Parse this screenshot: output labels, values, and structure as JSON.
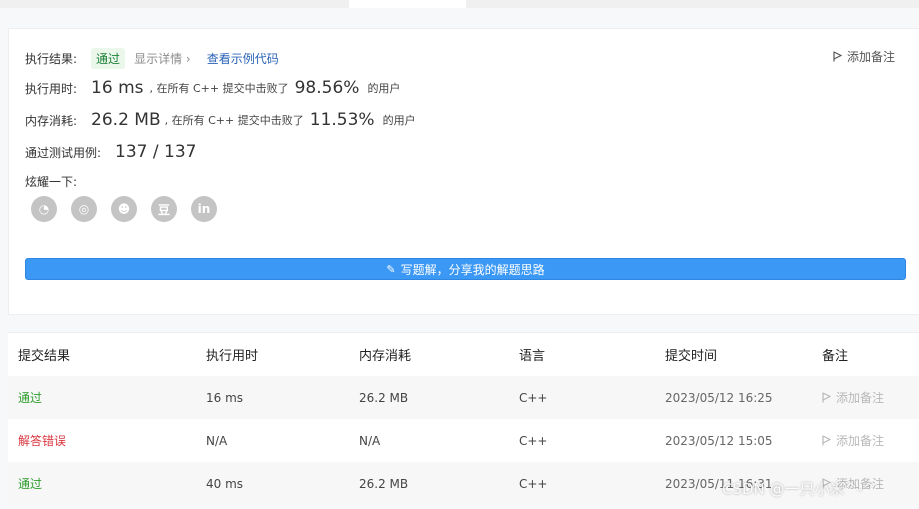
{
  "result": {
    "status_label": "执行结果:",
    "status_value": "通过",
    "show_detail": "显示详情",
    "detail_chevron": "›",
    "view_example_code": "查看示例代码",
    "add_note": "添加备注",
    "runtime_label": "执行用时:",
    "runtime_value": "16 ms",
    "runtime_mid": ", 在所有 C++ 提交中击败了",
    "runtime_percent": "98.56%",
    "runtime_suffix": "的用户",
    "memory_label": "内存消耗:",
    "memory_value": "26.2 MB",
    "memory_mid": ", 在所有 C++ 提交中击败了",
    "memory_percent": "11.53%",
    "memory_suffix": "的用户",
    "tests_label": "通过测试用例:",
    "tests_value": "137 / 137",
    "share_label": "炫耀一下:",
    "share_icons": [
      {
        "name": "wechat-icon",
        "glyph": "◔"
      },
      {
        "name": "weibo-icon",
        "glyph": "◎"
      },
      {
        "name": "qq-icon",
        "glyph": "☻"
      },
      {
        "name": "douban-icon",
        "glyph": "豆"
      },
      {
        "name": "linkedin-icon",
        "glyph": "in"
      }
    ],
    "write_solution": "写题解，分享我的解题思路"
  },
  "table": {
    "headers": [
      "提交结果",
      "执行用时",
      "内存消耗",
      "语言",
      "提交时间",
      "备注"
    ],
    "rows": [
      {
        "result": "通过",
        "runtime": "16 ms",
        "memory": "26.2 MB",
        "language": "C++",
        "time": "2023/05/12 16:25",
        "note": "添加备注"
      },
      {
        "result": "解答错误",
        "runtime": "N/A",
        "memory": "N/A",
        "language": "C++",
        "time": "2023/05/12 15:05",
        "note": "添加备注"
      },
      {
        "result": "通过",
        "runtime": "40 ms",
        "memory": "26.2 MB",
        "language": "C++",
        "time": "2023/05/11 16:31",
        "note": "添加备注"
      }
    ]
  },
  "watermark": "CSDN @一只小米^-^",
  "colors": {
    "accent": "#3b98f5",
    "accepted": "#2c9e2c",
    "wrong_answer": "#d9363e"
  }
}
